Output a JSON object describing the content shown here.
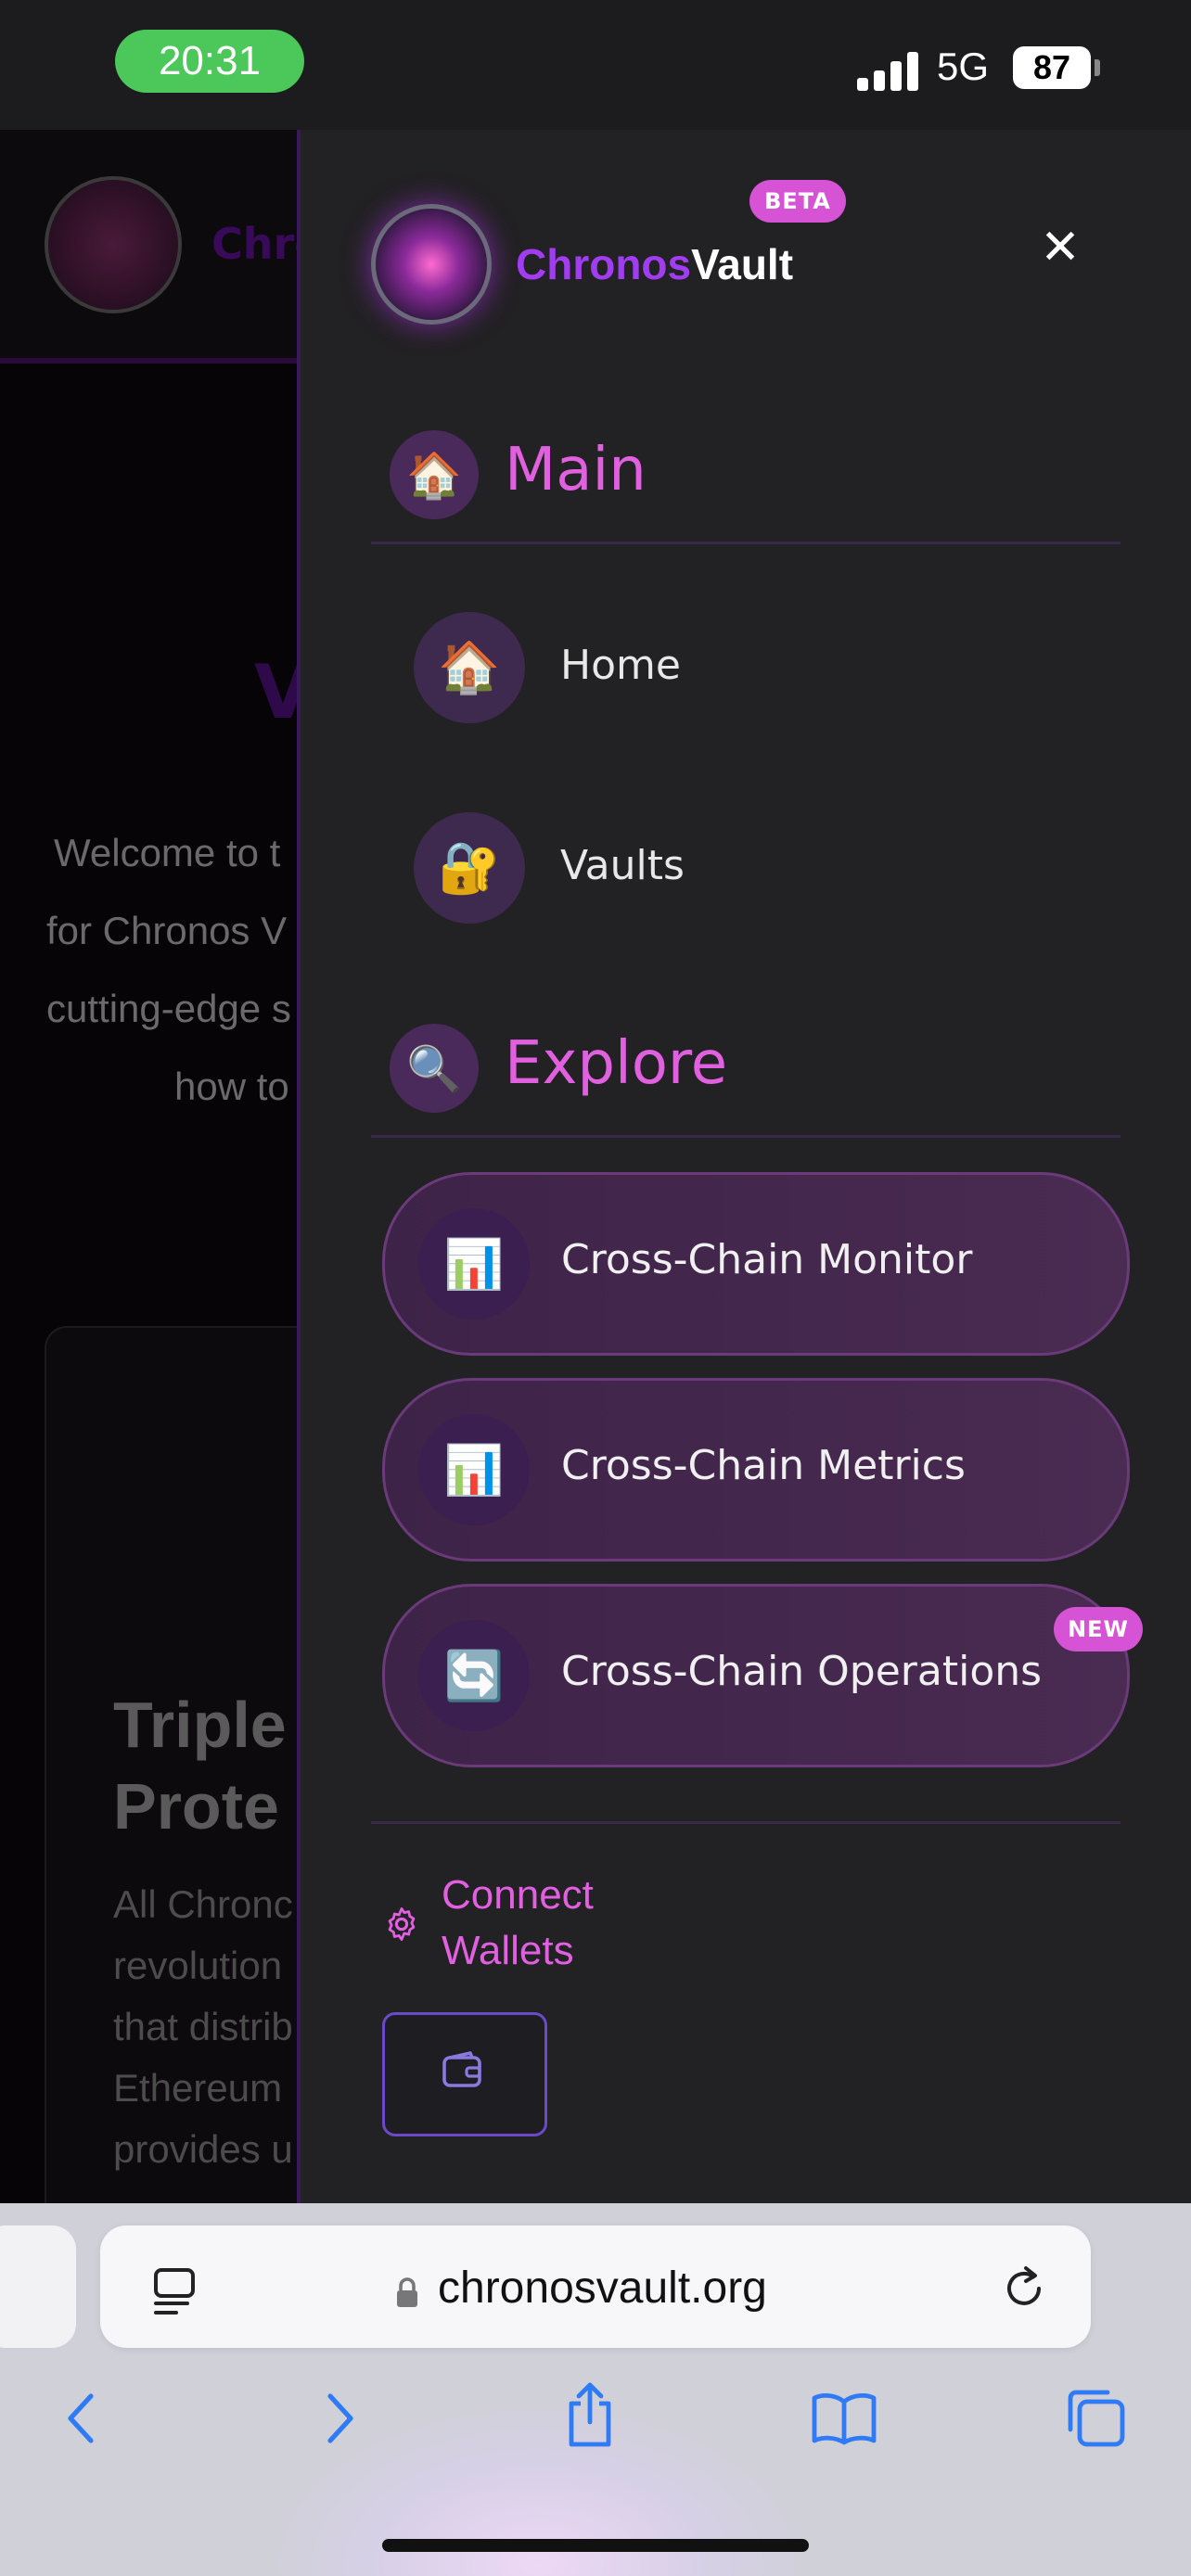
{
  "status_bar": {
    "time": "20:31",
    "network": "5G",
    "battery": "87"
  },
  "background_page": {
    "brand": "Chro",
    "title_fragment": "V",
    "intro_lines": [
      "Welcome to t",
      "for Chronos V",
      "cutting-edge s",
      "how to"
    ],
    "card_heading_lines": [
      "Triple",
      "Prote"
    ],
    "card_text_lines": [
      "All Chronc",
      "revolution",
      "that distrib",
      "Ethereum",
      "provides u"
    ]
  },
  "drawer": {
    "brand_part1": "Chronos",
    "brand_part2": "Vault",
    "beta_badge": "BETA",
    "close_glyph": "✕",
    "sections": {
      "main": {
        "title": "Main",
        "icon": "house-icon"
      },
      "explore": {
        "title": "Explore",
        "icon": "magnifier-icon"
      }
    },
    "main_items": [
      {
        "label": "Home",
        "icon": "house-icon"
      },
      {
        "label": "Vaults",
        "icon": "lock-key-icon"
      }
    ],
    "explore_items": [
      {
        "label": "Cross-Chain Monitor",
        "icon": "bar-chart-icon"
      },
      {
        "label": "Cross-Chain Metrics",
        "icon": "bar-chart-icon"
      },
      {
        "label": "Cross-Chain Operations",
        "icon": "refresh-icon"
      }
    ],
    "new_badge": "NEW",
    "connect_wallets": "Connect Wallets"
  },
  "browser": {
    "url": "chronosvault.org"
  },
  "colors": {
    "accent_pink": "#e060e0",
    "brand_purple": "#a23cf0",
    "badge_pink": "#d653d6",
    "drawer_bg": "#222123"
  }
}
